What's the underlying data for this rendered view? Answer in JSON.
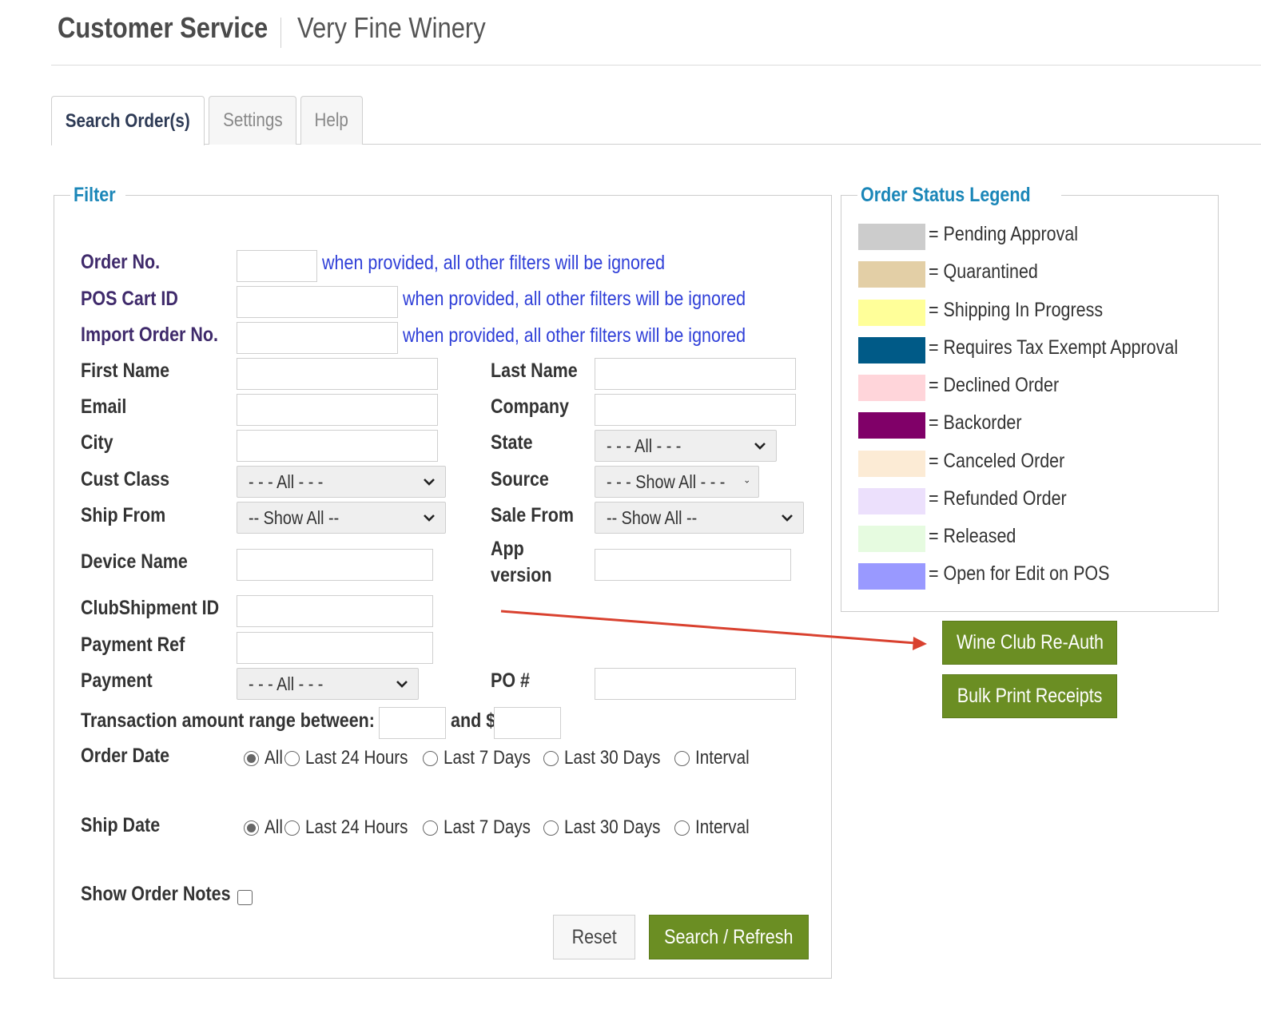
{
  "header": {
    "title": "Customer Service",
    "subtitle": "Very Fine Winery"
  },
  "tabs": [
    {
      "label": "Search Order(s)",
      "active": true
    },
    {
      "label": "Settings",
      "active": false
    },
    {
      "label": "Help",
      "active": false
    }
  ],
  "filter": {
    "legend": "Filter",
    "hint": "when provided, all other filters will be ignored",
    "labels": {
      "order_no": "Order No.",
      "pos_cart_id": "POS Cart ID",
      "import_order_no": "Import Order No.",
      "first_name": "First Name",
      "last_name": "Last Name",
      "email": "Email",
      "company": "Company",
      "city": "City",
      "state": "State",
      "cust_class": "Cust Class",
      "source": "Source",
      "ship_from": "Ship From",
      "sale_from": "Sale From",
      "device_name": "Device Name",
      "app_version_1": "App",
      "app_version_2": "version",
      "clubshipment_id": "ClubShipment ID",
      "payment_ref": "Payment Ref",
      "payment": "Payment",
      "po": "PO #",
      "transaction_range": "Transaction amount range between: $",
      "and": "and $",
      "order_date": "Order Date",
      "ship_date": "Ship Date",
      "show_order_notes": "Show Order Notes"
    },
    "selects": {
      "state": "- - - All - - -",
      "cust_class": "- - - All - - -",
      "source": "- - - Show All - - -",
      "ship_from": "-- Show All --",
      "sale_from": "-- Show All --",
      "payment": "- - - All - - -"
    },
    "date_options": [
      "All",
      "Last 24 Hours",
      "Last 7 Days",
      "Last 30 Days",
      "Interval"
    ],
    "order_date_selected": "All",
    "ship_date_selected": "All",
    "show_order_notes_checked": false,
    "buttons": {
      "reset": "Reset",
      "search": "Search / Refresh"
    }
  },
  "legend": {
    "title": "Order Status Legend",
    "items": [
      {
        "label": "= Pending Approval",
        "color": "#cccccc"
      },
      {
        "label": "= Quarantined",
        "color": "#e3cfa6"
      },
      {
        "label": "= Shipping In Progress",
        "color": "#ffff99"
      },
      {
        "label": "= Requires Tax Exempt Approval",
        "color": "#005a87"
      },
      {
        "label": "= Declined Order",
        "color": "#ffd5da"
      },
      {
        "label": "= Backorder",
        "color": "#800068"
      },
      {
        "label": "= Canceled Order",
        "color": "#fcebd5"
      },
      {
        "label": "= Refunded Order",
        "color": "#ece0fc"
      },
      {
        "label": "= Released",
        "color": "#e6fbe0"
      },
      {
        "label": "= Open for Edit on POS",
        "color": "#9999ff"
      }
    ]
  },
  "side_buttons": {
    "wine_club_reauth": "Wine Club Re-Auth",
    "bulk_print": "Bulk Print Receipts"
  },
  "colors": {
    "accent_green": "#6b8e23",
    "legend_blue": "#1a86b8",
    "hint_blue": "#2f3fd8",
    "arrow_red": "#d9412f"
  }
}
